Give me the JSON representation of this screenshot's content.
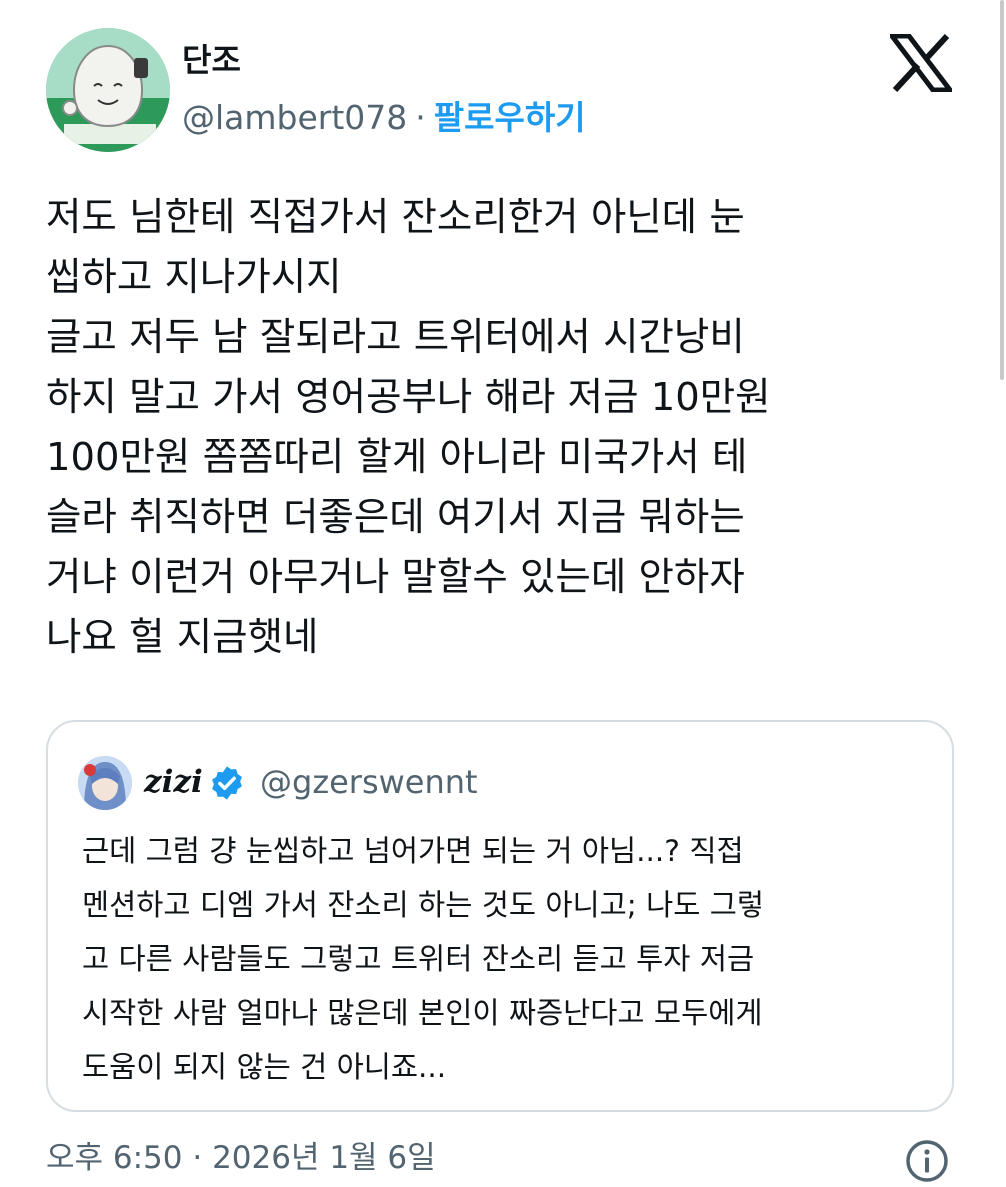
{
  "author": {
    "display_name": "단조",
    "handle": "@lambert078",
    "separator": "·",
    "follow_label": "팔로우하기",
    "avatar_icon": "mascot-avatar"
  },
  "brand_icon": "x-logo-icon",
  "tweet": {
    "lines": [
      "저도 님한테 직접가서 잔소리한거 아닌데 눈",
      "씹하고 지나가시지",
      "글고 저두 남 잘되라고 트위터에서 시간낭비",
      "하지 말고 가서 영어공부나 해라 저금 10만원",
      "100만원 쫌쫌따리 할게 아니라 미국가서 테",
      "슬라 취직하면 더좋은데 여기서 지금 뭐하는",
      "거냐 이런거 아무거나 말할수 있는데 안하자",
      "나요 헐 지금햇네"
    ]
  },
  "quote": {
    "display_name": "zizi",
    "verified_icon": "verified-badge-icon",
    "handle": "@gzerswennt",
    "lines": [
      "근데 그럼 걍 눈씹하고 넘어가면 되는 거 아님...? 직접",
      "멘션하고 디엠 가서 잔소리 하는 것도 아니고; 나도 그렇",
      "고 다른 사람들도 그렇고 트위터 잔소리 듣고 투자 저금",
      "시작한 사람 얼마나 많은데 본인이 짜증난다고 모두에게",
      "도움이 되지 않는 건 아니죠..."
    ]
  },
  "timestamp": "오후 6:50 · 2026년 1월 6일",
  "info_icon": "info-icon",
  "colors": {
    "link_blue": "#1d9bf0",
    "muted_gray": "#536471",
    "text": "#0f1419",
    "border": "#d6dde2"
  }
}
